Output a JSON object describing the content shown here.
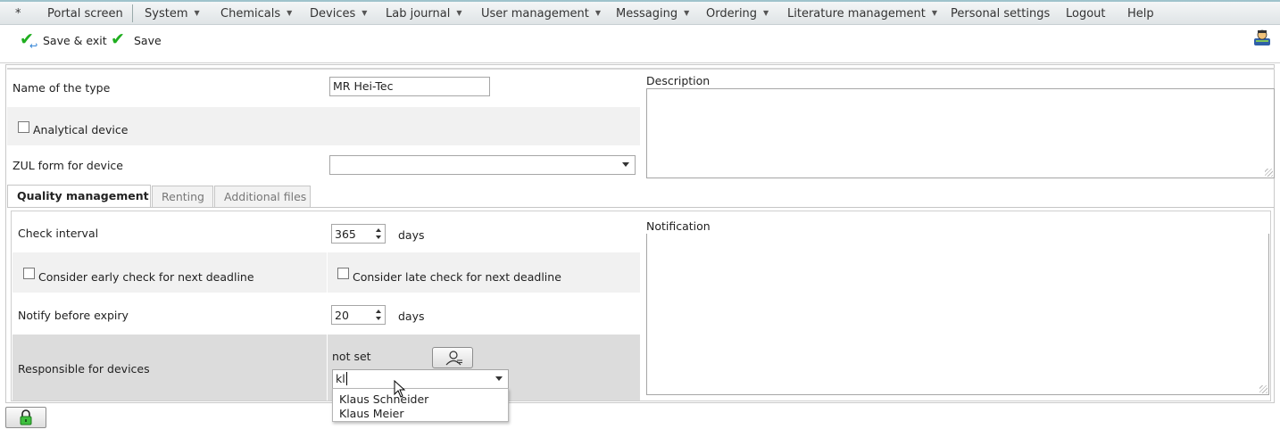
{
  "menu": {
    "items": [
      {
        "label": "*",
        "caret": false
      },
      {
        "label": "Portal screen",
        "caret": false
      },
      {
        "label": "System",
        "caret": true
      },
      {
        "label": "Chemicals",
        "caret": true
      },
      {
        "label": "Devices",
        "caret": true
      },
      {
        "label": "Lab journal",
        "caret": true
      },
      {
        "label": "User management",
        "caret": true
      },
      {
        "label": "Messaging",
        "caret": true
      },
      {
        "label": "Ordering",
        "caret": true
      },
      {
        "label": "Literature management",
        "caret": true
      },
      {
        "label": "Personal settings",
        "caret": false
      },
      {
        "label": "Logout",
        "caret": false
      },
      {
        "label": "Help",
        "caret": false
      }
    ]
  },
  "toolbar": {
    "save_exit_label": "Save & exit",
    "save_label": "Save"
  },
  "form": {
    "name_label": "Name of the type",
    "name_value": "MR Hei-Tec",
    "analytical_label": "Analytical device",
    "analytical_checked": false,
    "zul_label": "ZUL form for device",
    "zul_value": "",
    "description_label": "Description",
    "description_value": ""
  },
  "tabs": [
    {
      "label": "Quality management",
      "active": true
    },
    {
      "label": "Renting",
      "active": false
    },
    {
      "label": "Additional files",
      "active": false
    }
  ],
  "quality": {
    "check_interval_label": "Check interval",
    "check_interval_value": "365",
    "check_interval_unit": "days",
    "early_check_label": "Consider early check for next deadline",
    "late_check_label": "Consider late check for next deadline",
    "notify_label": "Notify before expiry",
    "notify_value": "20",
    "notify_unit": "days",
    "responsible_label": "Responsible for devices",
    "responsible_status": "not set",
    "responsible_input": "kl",
    "suggestions": [
      "Klaus Schneider",
      "Klaus Meier"
    ],
    "notification_label": "Notification"
  },
  "colors": {
    "menu_border": "#9fc3cc",
    "check_green": "#1fae1f",
    "shade": "#f1f1f1",
    "dark_shade": "#dcdcdc"
  }
}
